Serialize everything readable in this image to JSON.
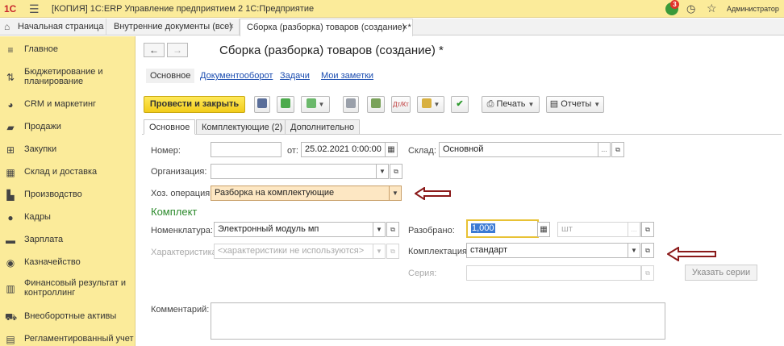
{
  "titlebar": {
    "logo": "1С",
    "title": "[КОПИЯ] 1С:ERP Управление предприятием 2 1С:Предприятие",
    "notifications_count": "3",
    "user": "Администратор"
  },
  "tabs": [
    {
      "label": "Начальная страница"
    },
    {
      "label": "Внутренние документы (все)"
    },
    {
      "label": "Сборка (разборка) товаров (создание) *"
    }
  ],
  "sidebar": {
    "items": [
      {
        "label": "Главное",
        "icon": "menu-icon"
      },
      {
        "label": "Бюджетирование и планирование",
        "icon": "chart-icon"
      },
      {
        "label": "CRM и маркетинг",
        "icon": "pie-icon"
      },
      {
        "label": "Продажи",
        "icon": "bag-icon"
      },
      {
        "label": "Закупки",
        "icon": "cart-icon"
      },
      {
        "label": "Склад и доставка",
        "icon": "warehouse-icon"
      },
      {
        "label": "Производство",
        "icon": "factory-icon"
      },
      {
        "label": "Кадры",
        "icon": "person-icon"
      },
      {
        "label": "Зарплата",
        "icon": "lines-icon"
      },
      {
        "label": "Казначейство",
        "icon": "coin-icon"
      },
      {
        "label": "Финансовый результат и контроллинг",
        "icon": "bars-icon"
      },
      {
        "label": "Внеоборотные активы",
        "icon": "car-icon"
      },
      {
        "label": "Регламентированный учет",
        "icon": "doc-icon"
      }
    ]
  },
  "document": {
    "title": "Сборка (разборка) товаров (создание) *",
    "subnav": [
      "Основное",
      "Документооборот",
      "Задачи",
      "Мои заметки"
    ],
    "toolbar": {
      "post_close": "Провести и закрыть",
      "print": "Печать",
      "reports": "Отчеты"
    },
    "form_tabs": [
      "Основное",
      "Комплектующие (2)",
      "Дополнительно"
    ],
    "fields": {
      "number_label": "Номер:",
      "number_value": "",
      "date_label": "от:",
      "date_value": "25.02.2021 0:00:00",
      "warehouse_label": "Склад:",
      "warehouse_value": "Основной",
      "organization_label": "Организация:",
      "organization_value": "",
      "operation_label": "Хоз. операция:",
      "operation_value": "Разборка на комплектующие",
      "section_title": "Комплект",
      "nomenclature_label": "Номенклатура:",
      "nomenclature_value": "Электронный модуль мп",
      "characteristic_label": "Характеристика:",
      "characteristic_value": "<характеристики не используются>",
      "disassembled_label": "Разобрано:",
      "disassembled_value": "1,000",
      "unit_placeholder": "шт",
      "kit_label": "Комплектация:",
      "kit_value": "стандарт",
      "series_label": "Серия:",
      "series_value": "",
      "specify_series": "Указать серии",
      "comment_label": "Комментарий:",
      "comment_value": ""
    }
  },
  "colors": {
    "sidebar_bg": "#fbeb9a",
    "primary_button": "#f2cc1b",
    "section_title": "#2c8a2c",
    "annotation_arrow": "#8b1a1a"
  }
}
